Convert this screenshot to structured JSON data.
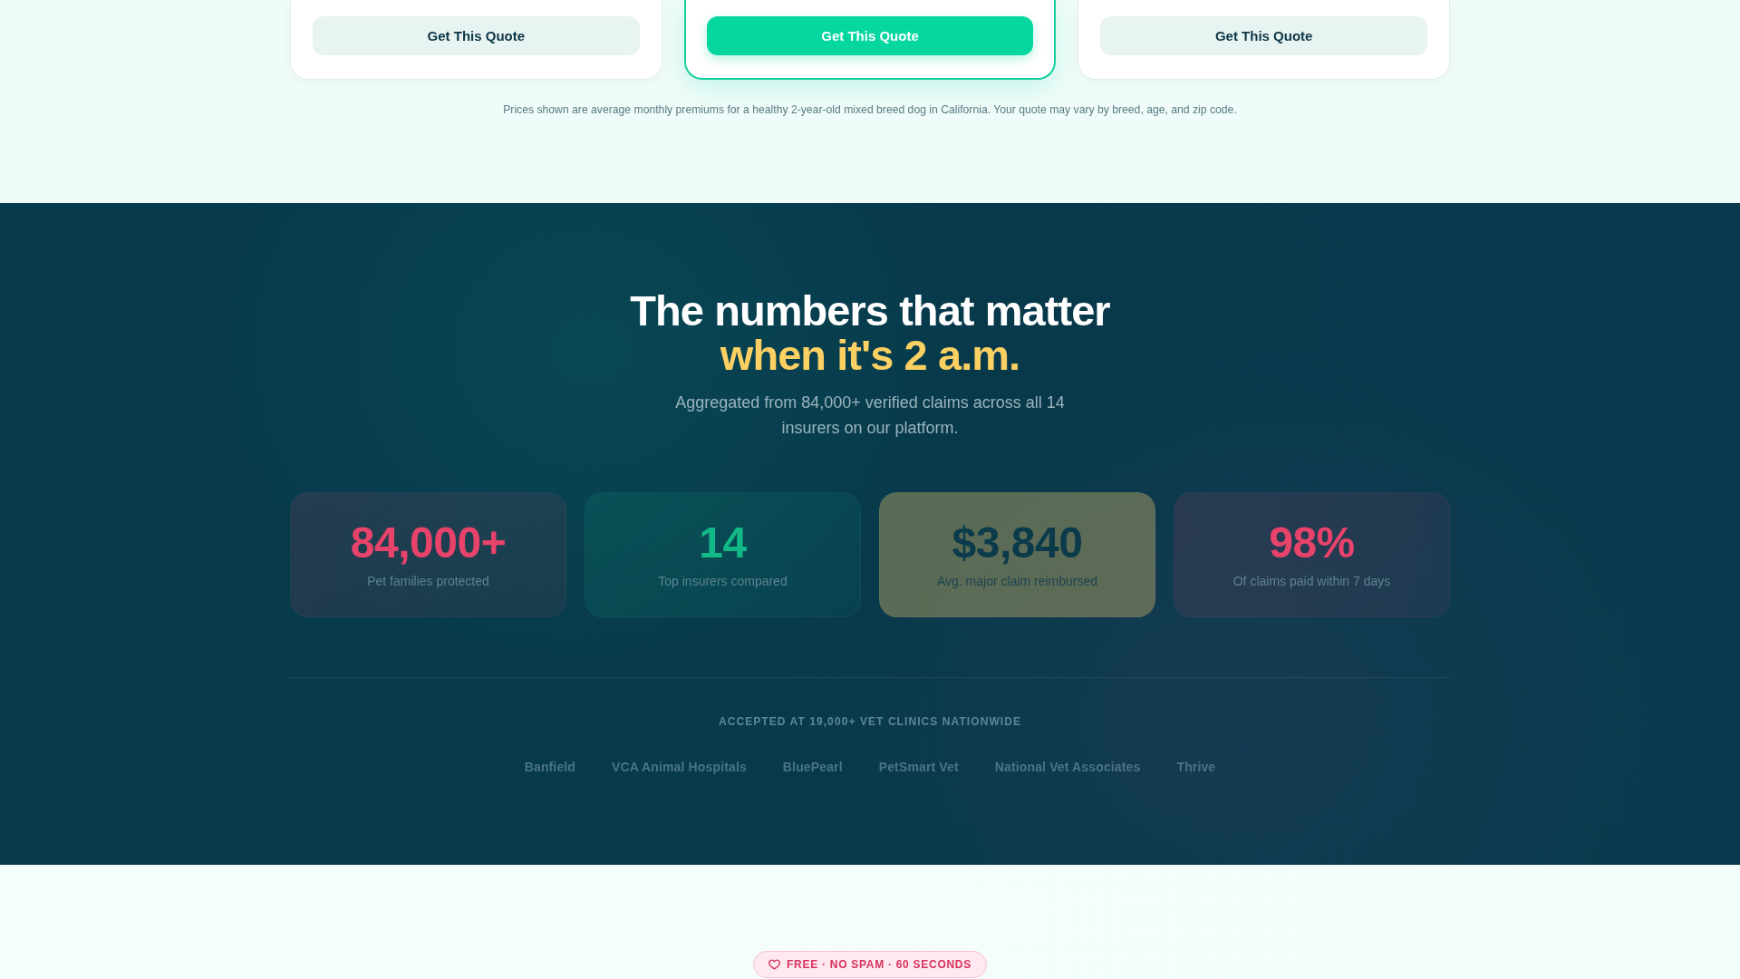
{
  "quote_cards": [
    {
      "button": "Get This Quote",
      "featured": false
    },
    {
      "button": "Get This Quote",
      "featured": true
    },
    {
      "button": "Get This Quote",
      "featured": false
    }
  ],
  "pricing_note": "Prices shown are average monthly premiums for a healthy 2-year-old mixed breed dog in California. Your quote may vary by breed, age, and zip code.",
  "stats_section": {
    "title": "The numbers that matter",
    "title_highlight": "when it's 2 a.m.",
    "subtitle": "Aggregated from 84,000+ verified claims across all 14 insurers on our platform.",
    "stats": [
      {
        "value": "84,000+",
        "label": "Pet families protected",
        "color": "#e8436b",
        "highlighted": false
      },
      {
        "value": "14",
        "label": "Top insurers compared",
        "color": "#12b886",
        "highlighted": false
      },
      {
        "value": "$3,840",
        "label": "Avg. major claim reimbursed",
        "color": "#0b3b4b",
        "highlighted": true
      },
      {
        "value": "98%",
        "label": "Of claims paid within 7 days",
        "color": "#e8436b",
        "highlighted": false
      }
    ],
    "clinics_heading": "ACCEPTED AT 19,000+ VET CLINICS NATIONWIDE",
    "clinics": [
      "Banfield",
      "VCA Animal Hospitals",
      "BluePearl",
      "PetSmart Vet",
      "National Vet Associates",
      "Thrive"
    ]
  },
  "cta_badge": {
    "text": "FREE · NO SPAM · 60 SECONDS"
  }
}
